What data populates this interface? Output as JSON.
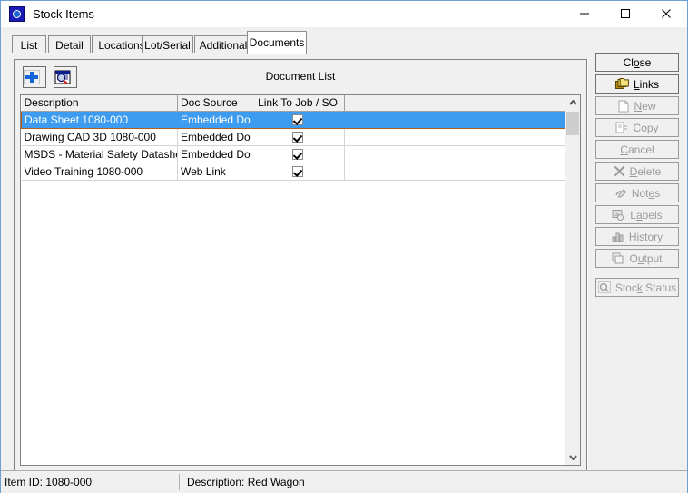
{
  "window": {
    "title": "Stock Items",
    "icon": "app-stock-icon",
    "controls": {
      "minimize": "minimize-icon",
      "maximize": "maximize-icon",
      "close": "close-icon"
    }
  },
  "tabs": [
    {
      "label": "List",
      "active": false
    },
    {
      "label": "Detail",
      "active": false
    },
    {
      "label": "Locations",
      "active": false
    },
    {
      "label": "Lot/Serial",
      "active": false
    },
    {
      "label": "Additional",
      "active": false
    },
    {
      "label": "Documents",
      "active": true
    }
  ],
  "document_panel": {
    "title": "Document List",
    "toolbar": [
      {
        "name": "add-document-button",
        "icon": "blue-plus-icon"
      },
      {
        "name": "view-document-button",
        "icon": "document-magnifier-icon"
      }
    ],
    "columns": [
      {
        "key": "description",
        "label": "Description"
      },
      {
        "key": "doc_source",
        "label": "Doc Source"
      },
      {
        "key": "link_to_job_so",
        "label": "Link To Job / SO"
      }
    ],
    "rows": [
      {
        "description": "Data Sheet 1080-000",
        "doc_source": "Embedded Doc",
        "link_to_job_so": true,
        "selected": true
      },
      {
        "description": "Drawing CAD 3D 1080-000",
        "doc_source": "Embedded Doc",
        "link_to_job_so": true,
        "selected": false
      },
      {
        "description": "MSDS - Material Safety Datasheet",
        "doc_source": "Embedded Doc",
        "link_to_job_so": true,
        "selected": false
      },
      {
        "description": "Video Training 1080-000",
        "doc_source": "Web Link",
        "link_to_job_so": true,
        "selected": false
      }
    ],
    "scrollbar": {
      "up_icon": "chevron-up-icon",
      "down_icon": "chevron-down-icon"
    }
  },
  "action_buttons": [
    {
      "name": "close-button",
      "label_pre": "Cl",
      "label_key": "o",
      "label_post": "se",
      "icon": "none",
      "enabled": true
    },
    {
      "name": "links-button",
      "label_pre": "",
      "label_key": "L",
      "label_post": "inks",
      "icon": "stacked-folders-icon",
      "enabled": true
    },
    {
      "name": "new-button",
      "label_pre": "",
      "label_key": "N",
      "label_post": "ew",
      "icon": "page-icon",
      "enabled": false
    },
    {
      "name": "copy-button",
      "label_pre": "Cop",
      "label_key": "y",
      "label_post": "",
      "icon": "copy-page-icon",
      "enabled": false
    },
    {
      "name": "cancel-button",
      "label_pre": "",
      "label_key": "C",
      "label_post": "ancel",
      "icon": "none",
      "enabled": false
    },
    {
      "name": "delete-button",
      "label_pre": "",
      "label_key": "D",
      "label_post": "elete",
      "icon": "x-cross-icon",
      "enabled": false
    },
    {
      "name": "notes-button",
      "label_pre": "Not",
      "label_key": "e",
      "label_post": "s",
      "icon": "notes-pen-icon",
      "enabled": false
    },
    {
      "name": "labels-button",
      "label_pre": "L",
      "label_key": "a",
      "label_post": "bels",
      "icon": "labels-tag-icon",
      "enabled": false
    },
    {
      "name": "history-button",
      "label_pre": "",
      "label_key": "H",
      "label_post": "istory",
      "icon": "bar-chart-icon",
      "enabled": false
    },
    {
      "name": "output-button",
      "label_pre": "O",
      "label_key": "u",
      "label_post": "tput",
      "icon": "windows-stack-icon",
      "enabled": false
    },
    {
      "name": "stock-status-button",
      "label_pre": "Stoc",
      "label_key": "k",
      "label_post": " Status",
      "icon": "magnifier-box-icon",
      "enabled": false
    }
  ],
  "statusbar": {
    "item_id": "Item ID: 1080-000",
    "description": "Description: Red Wagon"
  },
  "colors": {
    "selection_blue": "#3d9bf0",
    "selection_border": "#b45f17",
    "window_chrome": "#f0f0f0",
    "titlebar": "#ffffff"
  }
}
